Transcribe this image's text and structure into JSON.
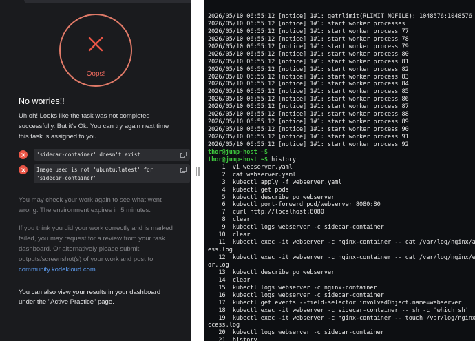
{
  "result": {
    "status_label": "Oops!",
    "heading": "No worries!!",
    "intro": "Uh oh! Looks like the task was not completed successfully. But it's Ok. You can try again next time this task is assigned to you.",
    "errors": [
      "'sidecar-container' doesn't exist",
      "Image used is not 'ubuntu:latest' for 'sidecar-container'"
    ],
    "check_note": "You may check your work again to see what went wrong. The environment expires in 5 minutes.",
    "review_note_prefix": "If you think you did your work correctly and is marked failed, you may request for a review from your task dashboard. Or alternatively please submit outputs/screenshot(s) of your work and post to ",
    "community_link": "community.kodekloud.com",
    "results_note": "You can also view your results in your dashboard under the \"Active Practice\" page.",
    "colors": {
      "error": "#ea5546",
      "badge_ring": "#e07a68",
      "link": "#5a97e8"
    }
  },
  "terminal": {
    "prompt": "thor@jump-host ~$",
    "lines": [
      {
        "kind": "out",
        "text": "2026/05/10 06:55:12 [notice] 1#1: getrlimit(RLIMIT_NOFILE): 1048576:1048576"
      },
      {
        "kind": "out",
        "text": "2026/05/10 06:55:12 [notice] 1#1: start worker processes"
      },
      {
        "kind": "out",
        "text": "2026/05/10 06:55:12 [notice] 1#1: start worker process 77"
      },
      {
        "kind": "out",
        "text": "2026/05/10 06:55:12 [notice] 1#1: start worker process 78"
      },
      {
        "kind": "out",
        "text": "2026/05/10 06:55:12 [notice] 1#1: start worker process 79"
      },
      {
        "kind": "out",
        "text": "2026/05/10 06:55:12 [notice] 1#1: start worker process 80"
      },
      {
        "kind": "out",
        "text": "2026/05/10 06:55:12 [notice] 1#1: start worker process 81"
      },
      {
        "kind": "out",
        "text": "2026/05/10 06:55:12 [notice] 1#1: start worker process 82"
      },
      {
        "kind": "out",
        "text": "2026/05/10 06:55:12 [notice] 1#1: start worker process 83"
      },
      {
        "kind": "out",
        "text": "2026/05/10 06:55:12 [notice] 1#1: start worker process 84"
      },
      {
        "kind": "out",
        "text": "2026/05/10 06:55:12 [notice] 1#1: start worker process 85"
      },
      {
        "kind": "out",
        "text": "2026/05/10 06:55:12 [notice] 1#1: start worker process 86"
      },
      {
        "kind": "out",
        "text": "2026/05/10 06:55:12 [notice] 1#1: start worker process 87"
      },
      {
        "kind": "out",
        "text": "2026/05/10 06:55:12 [notice] 1#1: start worker process 88"
      },
      {
        "kind": "out",
        "text": "2026/05/10 06:55:12 [notice] 1#1: start worker process 89"
      },
      {
        "kind": "out",
        "text": "2026/05/10 06:55:12 [notice] 1#1: start worker process 90"
      },
      {
        "kind": "out",
        "text": "2026/05/10 06:55:12 [notice] 1#1: start worker process 91"
      },
      {
        "kind": "out",
        "text": "2026/05/10 06:55:12 [notice] 1#1: start worker process 92"
      },
      {
        "kind": "prompt",
        "text": ""
      },
      {
        "kind": "prompt",
        "text": " history"
      },
      {
        "kind": "out",
        "text": "    1  vi webserver.yaml"
      },
      {
        "kind": "out",
        "text": "    2  cat webserver.yaml"
      },
      {
        "kind": "out",
        "text": "    3  kubectl apply -f webserver.yaml"
      },
      {
        "kind": "out",
        "text": "    4  kubectl get pods"
      },
      {
        "kind": "out",
        "text": "    5  kubectl describe po webserver"
      },
      {
        "kind": "out",
        "text": "    6  kubectl port-forward pod/webserver 8080:80"
      },
      {
        "kind": "out",
        "text": "    7  curl http://localhost:8080"
      },
      {
        "kind": "out",
        "text": "    8  clear"
      },
      {
        "kind": "out",
        "text": "    9  kubectl logs webserver -c sidecar-container"
      },
      {
        "kind": "out",
        "text": "   10  clear"
      },
      {
        "kind": "out",
        "text": "   11  kubectl exec -it webserver -c nginx-container -- cat /var/log/nginx/acc"
      },
      {
        "kind": "out",
        "text": "ess.log"
      },
      {
        "kind": "out",
        "text": "   12  kubectl exec -it webserver -c nginx-container -- cat /var/log/nginx/err"
      },
      {
        "kind": "out",
        "text": "or.log"
      },
      {
        "kind": "out",
        "text": "   13  kubectl describe po webserver"
      },
      {
        "kind": "out",
        "text": "   14  clear"
      },
      {
        "kind": "out",
        "text": "   15  kubectl logs webserver -c nginx-container"
      },
      {
        "kind": "out",
        "text": "   16  kubectl logs webserver -c sidecar-container"
      },
      {
        "kind": "out",
        "text": "   17  kubectl get events --field-selector involvedObject.name=webserver"
      },
      {
        "kind": "out",
        "text": "   18  kubectl exec -it webserver -c sidecar-container -- sh -c 'which sh'"
      },
      {
        "kind": "out",
        "text": "   19  kubectl exec -it webserver -c nginx-container -- touch /var/log/nginx/a"
      },
      {
        "kind": "out",
        "text": "ccess.log"
      },
      {
        "kind": "out",
        "text": "   20  kubectl logs webserver -c sidecar-container"
      },
      {
        "kind": "out",
        "text": "   21  history"
      },
      {
        "kind": "cursor",
        "text": " "
      }
    ],
    "colors": {
      "background": "#0d0f12",
      "prompt": "#3ec63e",
      "text": "#e8e8e8"
    }
  }
}
